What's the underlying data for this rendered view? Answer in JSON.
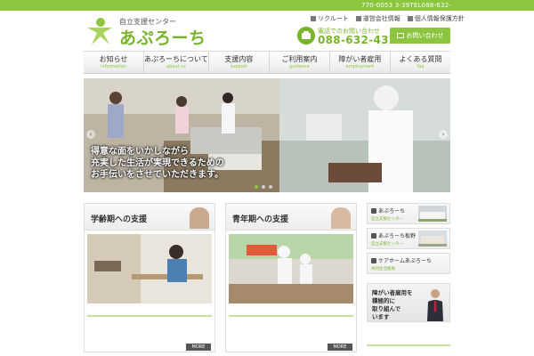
{
  "header": {
    "address": "770-0053 3-39TEL088-632-",
    "logo_sub": "自立支援センター",
    "logo_name": "あぷろーち",
    "top_links": [
      "リクルート",
      "運営会社情報",
      "個人情報保護方針"
    ],
    "phone_label": "電話でのお問い合わせ",
    "phone_number": "088-632-4322",
    "contact_button": "お問い合わせ"
  },
  "nav": [
    {
      "jp": "お知らせ",
      "en": "information"
    },
    {
      "jp": "あぷろーちについて",
      "en": "about us"
    },
    {
      "jp": "支援内容",
      "en": "support"
    },
    {
      "jp": "ご利用案内",
      "en": "guidance"
    },
    {
      "jp": "障がい者雇用",
      "en": "employment"
    },
    {
      "jp": "よくある質問",
      "en": "faq"
    }
  ],
  "hero": {
    "caption": [
      "得意な面をいかしながら",
      "充実した生活が実現できるための",
      "お手伝いをさせていただきます。"
    ],
    "slide_count": 3,
    "active_slide": 0
  },
  "cards": [
    {
      "title": "学齢期への支援",
      "more": "MORE"
    },
    {
      "title": "青年期への支援",
      "more": "MORE"
    }
  ],
  "side_links": [
    {
      "title": "あぷろーち",
      "sub": "自立支援センター"
    },
    {
      "title": "あぷろーち板野",
      "sub": "自立支援センター"
    },
    {
      "title": "ケアホームあぷろーち",
      "sub": "共同生活援助"
    }
  ],
  "recruit_banner": [
    "障がい者雇用を",
    "積極的に",
    "取り組んで",
    "います"
  ],
  "colors": {
    "accent": "#8cc63e",
    "accent_dark": "#7ab32e"
  }
}
